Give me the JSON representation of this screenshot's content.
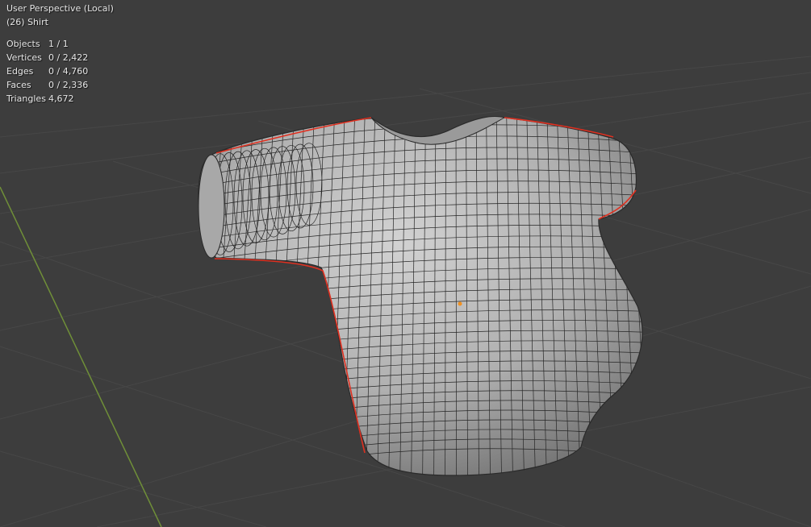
{
  "viewport": {
    "view_name": "User Perspective (Local)",
    "active_object": "(26) Shirt",
    "stats": [
      {
        "label": "Objects",
        "value": "1 / 1"
      },
      {
        "label": "Vertices",
        "value": "0 / 2,422"
      },
      {
        "label": "Edges",
        "value": "0 / 4,760"
      },
      {
        "label": "Faces",
        "value": "0 / 2,336"
      },
      {
        "label": "Triangles",
        "value": "4,672"
      }
    ],
    "colors": {
      "background": "#3d3d3d",
      "grid": "#4a4a4a",
      "axis_y": "#7a9a3a",
      "mesh_fill": "#b4b4b4",
      "wire": "#1e1e1e",
      "seam": "#e03020",
      "origin": "#f09020"
    }
  }
}
